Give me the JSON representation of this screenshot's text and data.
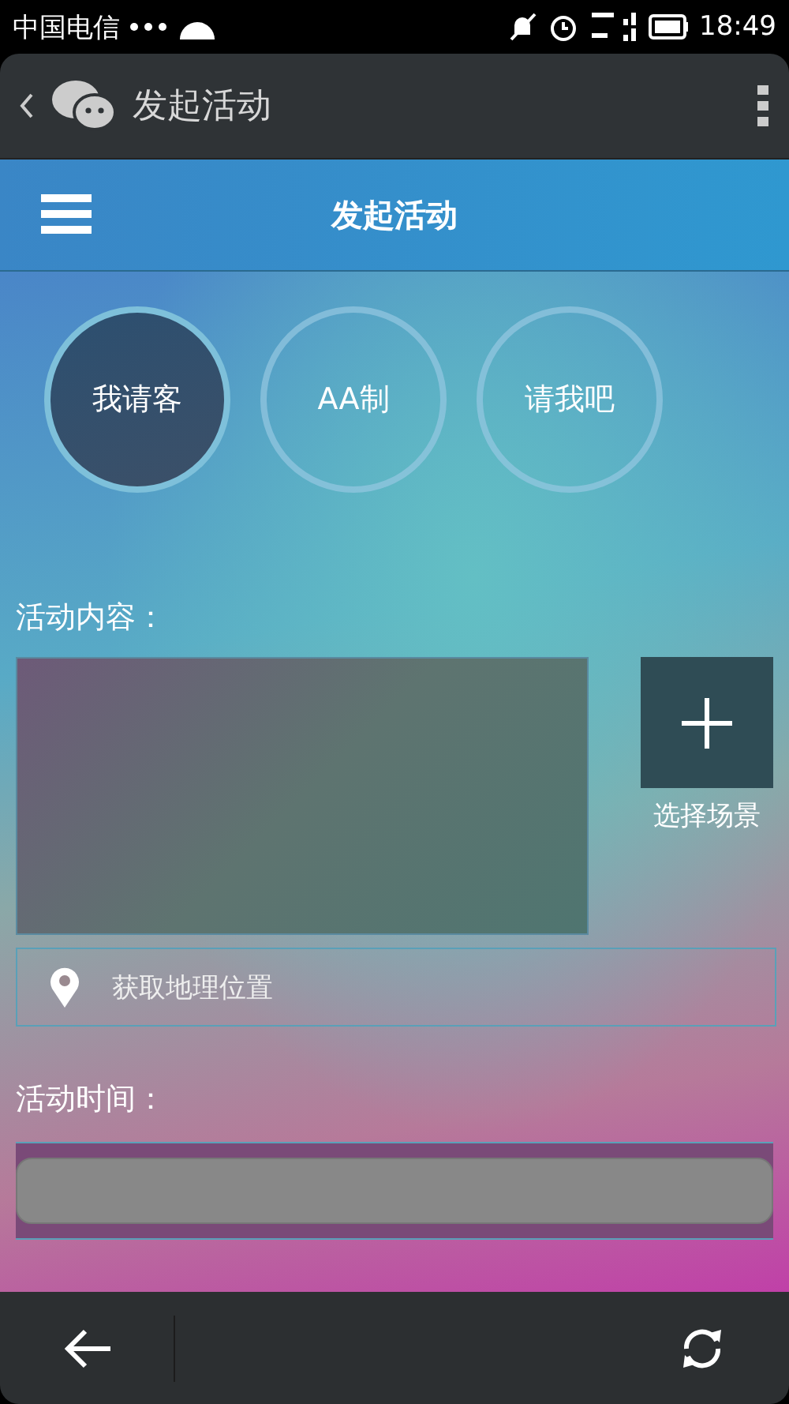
{
  "status_bar": {
    "carrier": "中国电信",
    "time": "18:49"
  },
  "app_bar": {
    "title": "发起活动"
  },
  "header": {
    "title": "发起活动"
  },
  "options": [
    {
      "label": "我请客",
      "selected": true
    },
    {
      "label": "AA制",
      "selected": false
    },
    {
      "label": "请我吧",
      "selected": false
    }
  ],
  "content_label": "活动内容：",
  "scene_button": {
    "label": "选择场景"
  },
  "location_button": {
    "label": "获取地理位置"
  },
  "time_label": "活动时间："
}
